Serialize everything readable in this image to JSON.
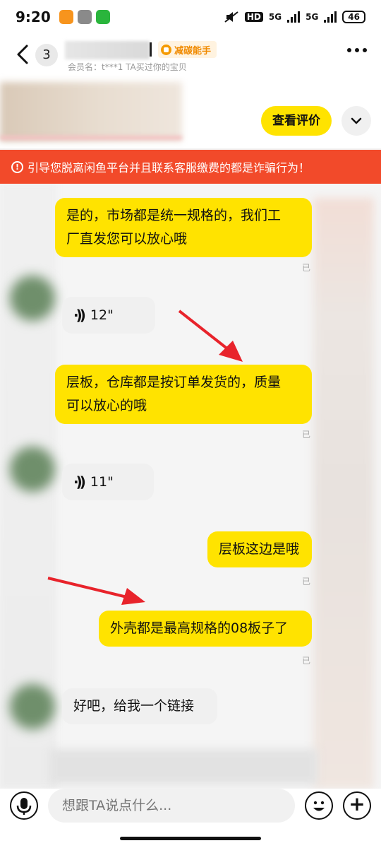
{
  "status_bar": {
    "time": "9:20",
    "network_a": "5G",
    "network_b": "5G",
    "hd": "HD",
    "battery": "46"
  },
  "header": {
    "unread_count": "3",
    "carbon_tag": "减碳能手",
    "member_line": "会员名：t***1  TA买过你的宝贝"
  },
  "item_card": {
    "review_button": "查看评价"
  },
  "warning": {
    "text": "引导您脱离闲鱼平台并且联系客服缴费的都是诈骗行为！"
  },
  "messages": [
    {
      "side": "me",
      "text_line1": "是的，市场都是统一规格的，我们工",
      "text_line2": "厂直发您可以放心哦",
      "read": "已"
    },
    {
      "side": "other",
      "type": "voice",
      "duration": "12\""
    },
    {
      "side": "me",
      "text_line1": "层板，仓库都是按订单发货的，质量",
      "text_line2": "可以放心的哦",
      "read": "已"
    },
    {
      "side": "other",
      "type": "voice",
      "duration": "11\""
    },
    {
      "side": "me",
      "text_line1": "层板这边是哦",
      "read": "已"
    },
    {
      "side": "me",
      "text_line1": "外壳都是最高规格的08板子了",
      "read": "已"
    },
    {
      "side": "other",
      "text_line1": "好吧，给我一个链接"
    }
  ],
  "input_bar": {
    "placeholder": "想跟TA说点什么..."
  },
  "colors": {
    "accent_yellow": "#ffe300",
    "warning_red": "#f24a2a",
    "arrow_red": "#e8232b",
    "carbon_orange": "#f08a00"
  },
  "icons": [
    "back-icon",
    "mic-icon",
    "emoji-icon",
    "plus-icon",
    "more-icon",
    "chevron-down-icon",
    "voice-wave-icon",
    "warning-icon"
  ]
}
